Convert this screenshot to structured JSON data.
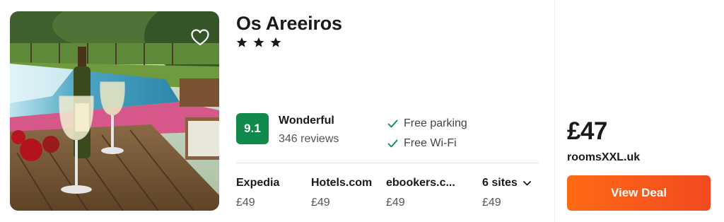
{
  "hotel": {
    "name": "Os Areeiros",
    "stars": 3,
    "star_glyph": "★"
  },
  "rating": {
    "score": "9.1",
    "label": "Wonderful",
    "reviews": "346 reviews",
    "badge_color": "#0f8a4c"
  },
  "amenities": [
    {
      "label": "Free parking",
      "icon": "check-icon"
    },
    {
      "label": "Free Wi-Fi",
      "icon": "check-icon"
    }
  ],
  "sites": [
    {
      "name": "Expedia",
      "price": "£49"
    },
    {
      "name": "Hotels.com",
      "price": "£49"
    },
    {
      "name": "ebookers.c...",
      "price": "£49"
    },
    {
      "name": "6 sites",
      "price": "£49",
      "icon": "chevron-down-icon"
    }
  ],
  "deal": {
    "price": "£47",
    "provider": "roomsXXL.uk",
    "button_label": "View Deal",
    "button_color": "#ff5a1f"
  },
  "photo": {
    "icon": "heart-icon"
  }
}
